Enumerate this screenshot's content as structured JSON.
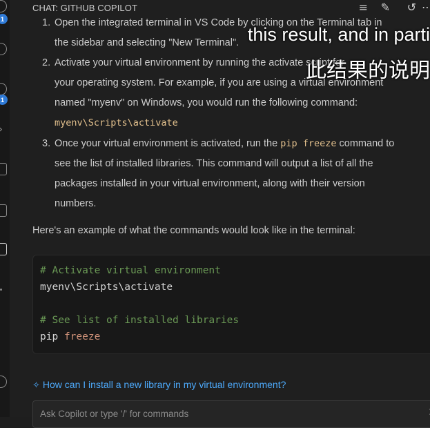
{
  "panel": {
    "title": "CHAT: GITHUB COPILOT",
    "icons": [
      "list-filter-icon",
      "new-chat-icon",
      "history-icon",
      "more-icon"
    ]
  },
  "activity_bar": {
    "badges": [
      "1",
      "1"
    ]
  },
  "steps": [
    {
      "num": "1.",
      "lines": [
        "Open the integrated terminal in VS Code by clicking on the Terminal tab in",
        "the sidebar and selecting \"New Terminal\"."
      ]
    },
    {
      "num": "2.",
      "lines": [
        "Activate your virtual environment by running the activate script for",
        "your operating system. For example, if you are using a virtual environment",
        "named \"myenv\" on Windows, you would run the following command:"
      ],
      "code": "myenv\\Scripts\\activate"
    },
    {
      "num": "3.",
      "line1_before": "Once your virtual environment is activated, run the ",
      "line1_code": "pip freeze",
      "line1_after": " command to",
      "lines": [
        "see the list of installed libraries. This command will output a list of all the",
        "packages installed in your virtual environment, along with their version",
        "numbers."
      ]
    }
  ],
  "example_intro": "Here's an example of what the commands would look like in the terminal:",
  "code_block": {
    "comment1": "# Activate virtual environment",
    "line1": "myenv\\Scripts\\activate",
    "comment2": "# See list of installed libraries",
    "line2_cmd": "pip",
    "line2_arg": "freeze"
  },
  "suggestion": "How can I install a new library in my virtual environment?",
  "chat_input": {
    "placeholder": "Ask Copilot or type '/' for commands"
  },
  "subtitles": {
    "english": "this result, and in parti",
    "chinese": "此结果的说明"
  },
  "colors": {
    "accent": "#4daafc",
    "badge": "#2f7ad6",
    "inline_code": "#e2c08d",
    "comment": "#6a9955"
  }
}
